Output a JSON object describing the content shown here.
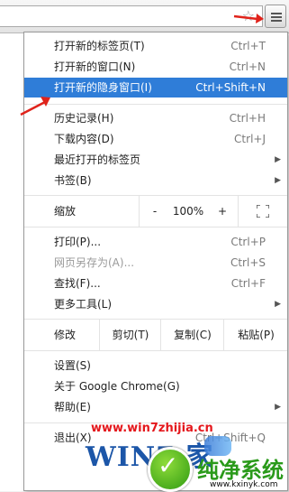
{
  "toolbar": {
    "star_icon": "star-icon",
    "menu_icon": "hamburger-menu-icon"
  },
  "menu": {
    "items": [
      {
        "label": "打开新的标签页(T)",
        "shortcut": "Ctrl+T"
      },
      {
        "label": "打开新的窗口(N)",
        "shortcut": "Ctrl+N"
      },
      {
        "label": "打开新的隐身窗口(I)",
        "shortcut": "Ctrl+Shift+N"
      },
      {
        "label": "历史记录(H)",
        "shortcut": "Ctrl+H"
      },
      {
        "label": "下载内容(D)",
        "shortcut": "Ctrl+J"
      },
      {
        "label": "最近打开的标签页",
        "shortcut": ""
      },
      {
        "label": "书签(B)",
        "shortcut": ""
      },
      {
        "label": "打印(P)...",
        "shortcut": "Ctrl+P"
      },
      {
        "label": "网页另存为(A)...",
        "shortcut": "Ctrl+S"
      },
      {
        "label": "查找(F)...",
        "shortcut": "Ctrl+F"
      },
      {
        "label": "更多工具(L)",
        "shortcut": ""
      },
      {
        "label": "设置(S)",
        "shortcut": ""
      },
      {
        "label": "关于 Google Chrome(G)",
        "shortcut": ""
      },
      {
        "label": "帮助(E)",
        "shortcut": ""
      },
      {
        "label": "退出(X)",
        "shortcut": "Ctrl+Shift+Q"
      }
    ],
    "zoom": {
      "label": "缩放",
      "minus": "-",
      "value": "100%",
      "plus": "+"
    },
    "edit": {
      "label": "修改",
      "cut": "剪切(T)",
      "copy": "复制(C)",
      "paste": "粘贴(P)"
    },
    "highlight_color": "#2f7dd8"
  },
  "watermark": {
    "site": "www.win7zhijia.cn",
    "logo": "WIN7 家",
    "circle_glyph": "✓",
    "chinese": "纯净系统",
    "url": "www.kxinyk.com"
  },
  "annotation_color": "#e0231b"
}
